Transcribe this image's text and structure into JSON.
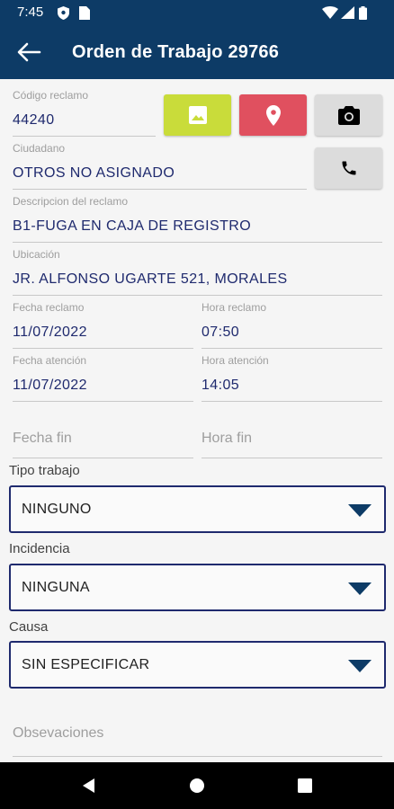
{
  "status_bar": {
    "time": "7:45"
  },
  "app_bar": {
    "title": "Orden de Trabajo 29766"
  },
  "fields": {
    "codigo": {
      "label": "Código reclamo",
      "value": "44240"
    },
    "ciudadano": {
      "label": "Ciudadano",
      "value": "OTROS NO ASIGNADO"
    },
    "descripcion": {
      "label": "Descripcion del reclamo",
      "value": "B1-FUGA EN CAJA DE REGISTRO"
    },
    "ubicacion": {
      "label": "Ubicación",
      "value": "JR. ALFONSO UGARTE 521, MORALES"
    },
    "fecha_reclamo": {
      "label": "Fecha reclamo",
      "value": "11/07/2022"
    },
    "hora_reclamo": {
      "label": "Hora reclamo",
      "value": "07:50"
    },
    "fecha_atencion": {
      "label": "Fecha atención",
      "value": "11/07/2022"
    },
    "hora_atencion": {
      "label": "Hora atención",
      "value": "14:05"
    },
    "fecha_fin": {
      "placeholder": "Fecha fin"
    },
    "hora_fin": {
      "placeholder": "Hora fin"
    },
    "observaciones": {
      "placeholder": "Obsevaciones"
    }
  },
  "dropdowns": {
    "tipo_trabajo": {
      "label": "Tipo trabajo",
      "value": "NINGUNO"
    },
    "incidencia": {
      "label": "Incidencia",
      "value": "NINGUNA"
    },
    "causa": {
      "label": "Causa",
      "value": "SIN ESPECIFICAR"
    }
  },
  "colors": {
    "primary": "#0d3b66",
    "text_value": "#1f2a6e",
    "image_button": "#c9dc3a",
    "location_button": "#e0505f",
    "grey_button": "#dcdcdc"
  },
  "icons": [
    "shield-icon",
    "sim-icon",
    "wifi-icon",
    "signal-icon",
    "battery-icon",
    "back-arrow-icon",
    "image-icon",
    "location-pin-icon",
    "camera-icon",
    "phone-icon",
    "dropdown-caret-icon",
    "nav-back-icon",
    "nav-home-icon",
    "nav-recents-icon"
  ]
}
